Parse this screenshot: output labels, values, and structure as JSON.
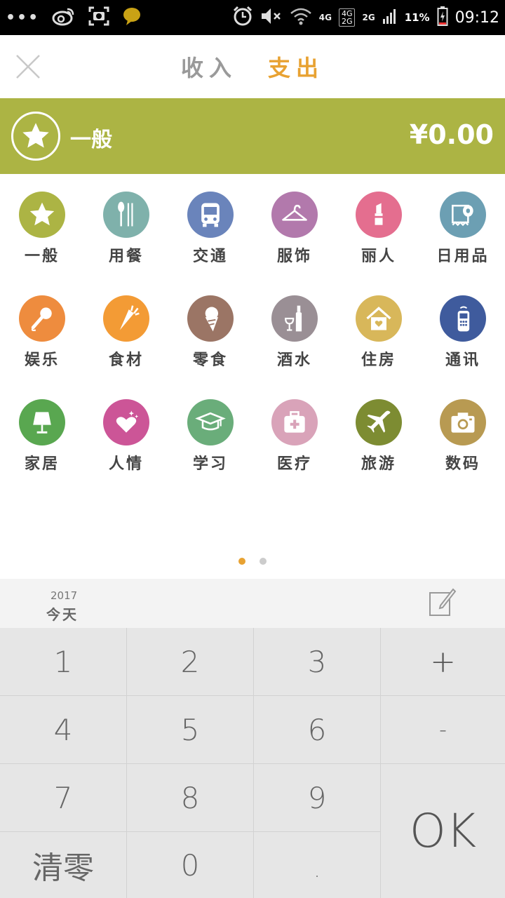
{
  "status_bar": {
    "dots": "•••",
    "network_top": "4G",
    "network_box_top": "4G",
    "network_box_bottom": "2G",
    "network_2g": "2G",
    "battery": "11%",
    "time": "09:12"
  },
  "header": {
    "tabs": [
      {
        "label": "收入",
        "active": false
      },
      {
        "label": "支出",
        "active": true
      }
    ]
  },
  "banner": {
    "category": "一般",
    "amount": "¥0.00",
    "color": "#acb444"
  },
  "categories": [
    {
      "label": "一般",
      "icon": "star-icon",
      "color": "#acb444"
    },
    {
      "label": "用餐",
      "icon": "utensils-icon",
      "color": "#7fb1ab"
    },
    {
      "label": "交通",
      "icon": "bus-icon",
      "color": "#6a84bb"
    },
    {
      "label": "服饰",
      "icon": "hanger-icon",
      "color": "#b279ac"
    },
    {
      "label": "丽人",
      "icon": "lipstick-icon",
      "color": "#e46e8f"
    },
    {
      "label": "日用品",
      "icon": "toilet-paper-icon",
      "color": "#6c9fb3"
    },
    {
      "label": "娱乐",
      "icon": "microphone-icon",
      "color": "#ee8c3e"
    },
    {
      "label": "食材",
      "icon": "carrot-icon",
      "color": "#f39b35"
    },
    {
      "label": "零食",
      "icon": "ice-cream-icon",
      "color": "#9b7565"
    },
    {
      "label": "酒水",
      "icon": "bottle-icon",
      "color": "#9a8f95"
    },
    {
      "label": "住房",
      "icon": "house-icon",
      "color": "#d8b75a"
    },
    {
      "label": "通讯",
      "icon": "phone-icon",
      "color": "#3f5b9d"
    },
    {
      "label": "家居",
      "icon": "lamp-icon",
      "color": "#59a750"
    },
    {
      "label": "人情",
      "icon": "heart-sparkle-icon",
      "color": "#cc5597"
    },
    {
      "label": "学习",
      "icon": "graduation-cap-icon",
      "color": "#6aad7a"
    },
    {
      "label": "医疗",
      "icon": "medical-kit-icon",
      "color": "#d9a3b9"
    },
    {
      "label": "旅游",
      "icon": "airplane-icon",
      "color": "#7d8c32"
    },
    {
      "label": "数码",
      "icon": "camera-icon",
      "color": "#b89a52"
    }
  ],
  "pager": {
    "pages": 2,
    "current": 1
  },
  "date": {
    "year": "2017",
    "label": "今天"
  },
  "keypad": {
    "k1": "1",
    "k2": "2",
    "k3": "3",
    "plus": "+",
    "k4": "4",
    "k5": "5",
    "k6": "6",
    "minus": "-",
    "k7": "7",
    "k8": "8",
    "k9": "9",
    "ok": "OK",
    "clear": "清零",
    "k0": "0",
    "dot": "."
  },
  "accent_color": "#e8a232"
}
